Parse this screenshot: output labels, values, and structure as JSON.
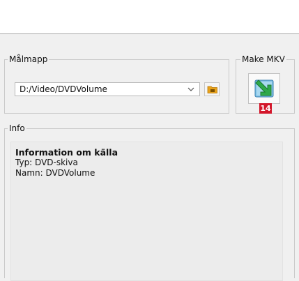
{
  "target_folder": {
    "legend": "Målmapp",
    "path_value": "D:/Video/DVDVolume",
    "browse_icon": "folder-icon",
    "dropdown_icon": "chevron-down-icon"
  },
  "make_mkv": {
    "legend": "Make MKV",
    "button_icon": "make-mkv-arrow-icon",
    "badge": "14"
  },
  "info": {
    "legend": "Info",
    "title": "Information om källa",
    "type_line": "Typ: DVD-skiva",
    "name_line": "Namn: DVDVolume"
  },
  "colors": {
    "badge": "#d3162a",
    "folder_icon": "#e8a21a",
    "arrow_icon": "#2ea84a"
  }
}
